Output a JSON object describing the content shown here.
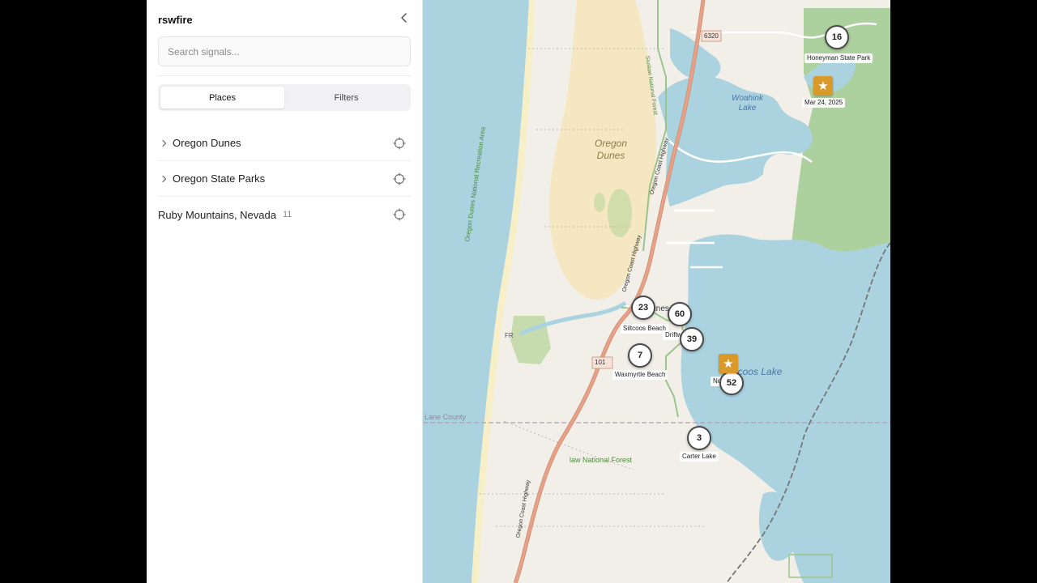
{
  "app": {
    "title": "rswfire"
  },
  "search": {
    "placeholder": "Search signals..."
  },
  "tabs": [
    {
      "label": "Places",
      "active": true
    },
    {
      "label": "Filters",
      "active": false
    }
  ],
  "places": [
    {
      "label": "Oregon Dunes",
      "expandable": true,
      "count": ""
    },
    {
      "label": "Oregon State Parks",
      "expandable": true,
      "count": ""
    },
    {
      "label": "Ruby Mountains, Nevada",
      "expandable": false,
      "count": "11"
    }
  ],
  "map": {
    "clusters": [
      {
        "count": "16",
        "label": "Honeyman State Park"
      },
      {
        "count": "23",
        "label": "Siltcoos Beach"
      },
      {
        "count": "60",
        "label": "Driftw"
      },
      {
        "count": "39",
        "label": ""
      },
      {
        "count": "7",
        "label": "Waxmyrtle Beach"
      },
      {
        "count": "52",
        "label": "No"
      },
      {
        "count": "3",
        "label": "Carter Lake"
      }
    ],
    "stars": [
      {
        "label": "Mar 24, 2025"
      },
      {
        "label": ""
      }
    ],
    "labels": {
      "oregon_dunes_line1": "Oregon",
      "oregon_dunes_line2": "Dunes",
      "woahink_line1": "Woahink",
      "woahink_line2": "Lake",
      "siltcoos_lake": "Siltcoos Lake",
      "dunes_city": "Dunes City",
      "lane_county": "Lane County",
      "national_forest": "law National Forest",
      "shield_101": "101",
      "shield_top": "6320",
      "recreation_area": "Oregon Dunes National Recreation Area",
      "coast_highway": "Oregon Coast Highway",
      "forest_vertical": "Siuslaw National Forest",
      "fr": "FR"
    },
    "colors": {
      "water": "#aad3df",
      "land": "#f2efe9",
      "sand": "#f5e9c6",
      "forest": "#add19e",
      "road": "#e8a087",
      "accent": "#d99a2b"
    },
    "icons": {
      "cluster": "circle-count-icon",
      "star": "star-icon"
    }
  }
}
